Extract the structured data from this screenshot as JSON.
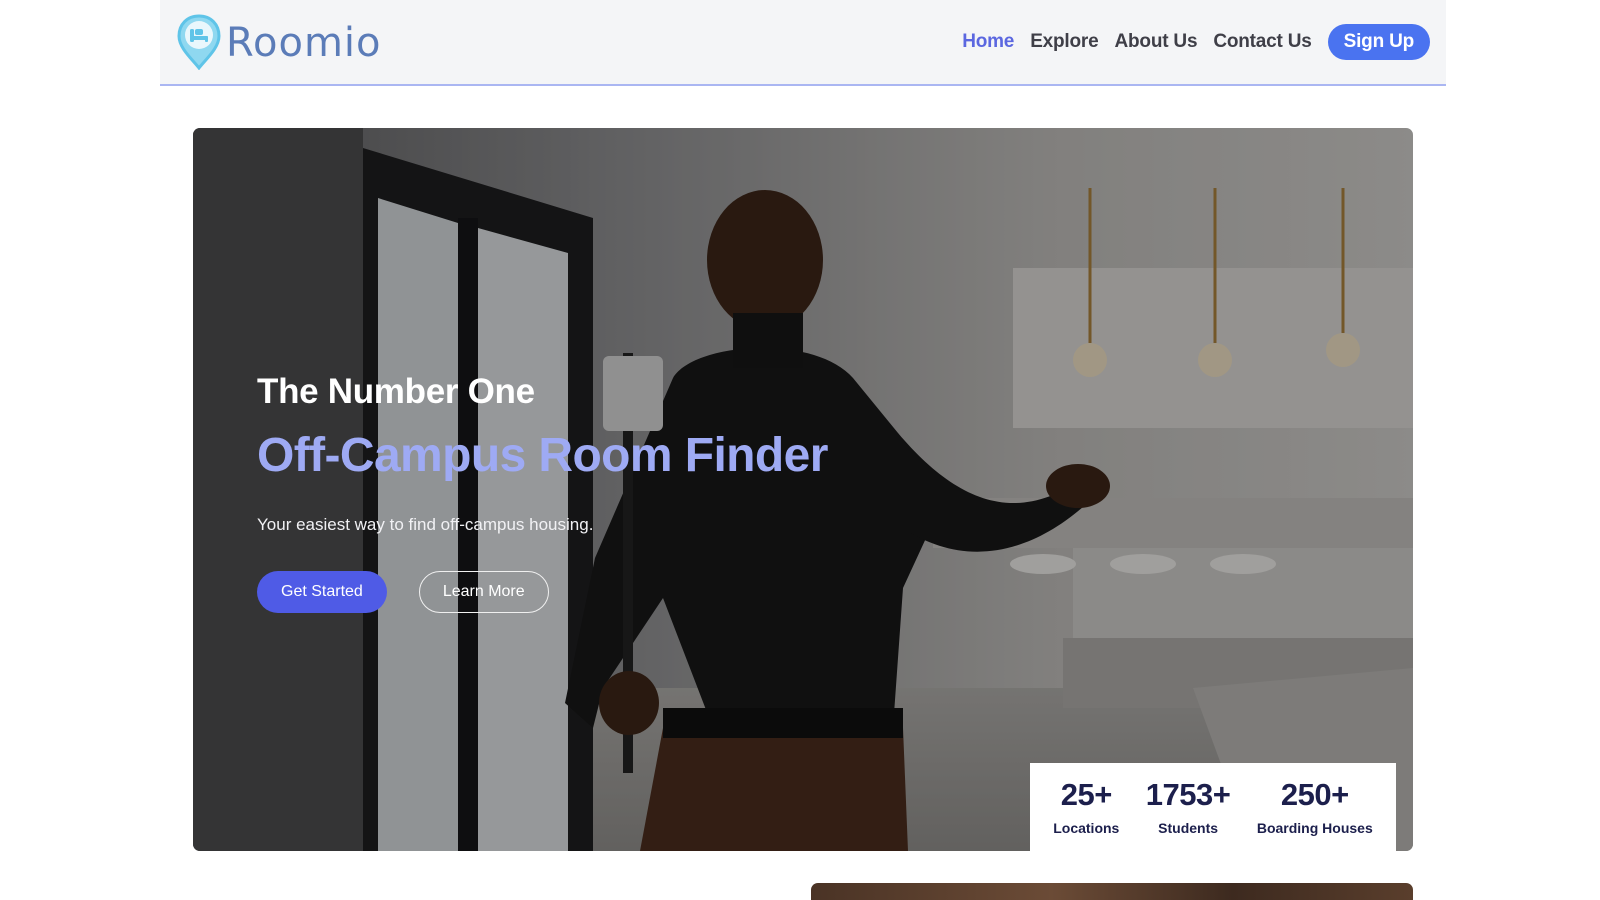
{
  "brand": {
    "name": "Roomio",
    "pin_color": "#5fc4e8",
    "name_color": "#5b7cb8"
  },
  "nav": {
    "links": [
      {
        "label": "Home",
        "active": true
      },
      {
        "label": "Explore",
        "active": false
      },
      {
        "label": "About Us",
        "active": false
      },
      {
        "label": "Contact Us",
        "active": false
      }
    ],
    "signup_label": "Sign Up"
  },
  "hero": {
    "kicker": "The Number One",
    "title": "Off-Campus Room Finder",
    "subtitle": "Your easiest way to find off-campus housing.",
    "primary_cta": "Get Started",
    "secondary_cta": "Learn More",
    "background": "photo-man-filming-selfie-in-kitchen"
  },
  "stats": [
    {
      "value": "25+",
      "label": "Locations"
    },
    {
      "value": "1753+",
      "label": "Students"
    },
    {
      "value": "250+",
      "label": "Boarding Houses"
    }
  ],
  "colors": {
    "accent": "#4a73f0",
    "title_accent": "#9eaaf4",
    "primary_button": "#4f5be6",
    "stats_text": "#1c1f4c",
    "navbar_border": "#aab6f2"
  }
}
